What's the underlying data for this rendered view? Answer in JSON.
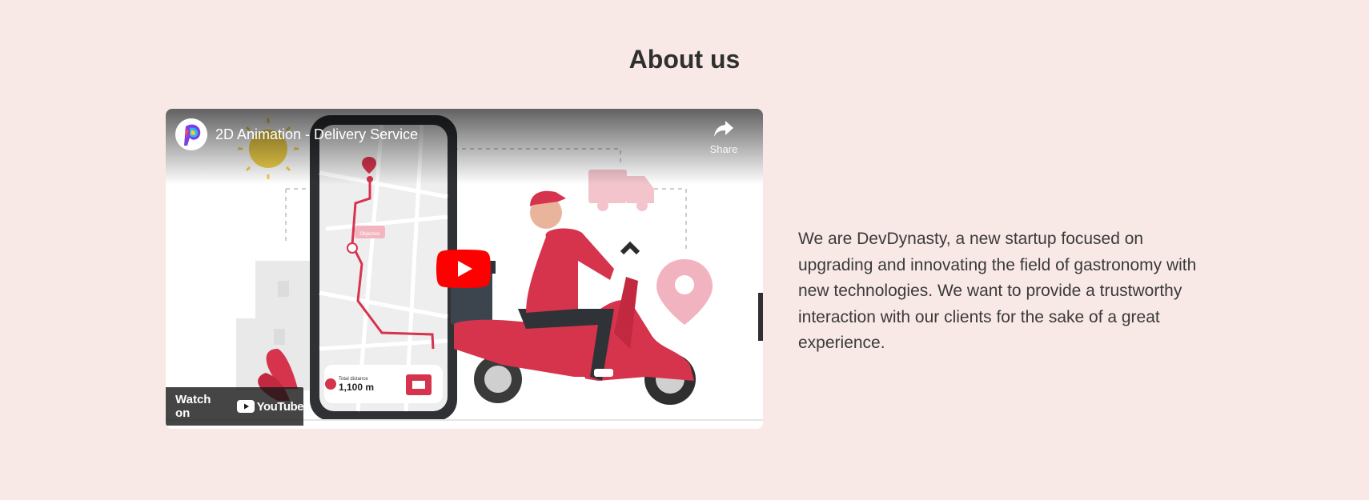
{
  "section": {
    "title": "About us",
    "description": "We are DevDynasty, a new startup focused on upgrading and innovating the field of gastronomy with new technologies. We want to provide a trustworthy interaction with our clients for the sake of a great experience."
  },
  "video": {
    "title": "2D Animation - Delivery Service",
    "share_label": "Share",
    "watch_on_label": "Watch on",
    "youtube_label": "YouTube",
    "play_icon": "play-icon",
    "share_icon": "share-icon",
    "thumbnail": {
      "map_tag": "Objective",
      "distance_label": "Total distance",
      "distance_value": "1,100 m"
    }
  },
  "colors": {
    "background": "#f8e9e7",
    "accent_red": "#d6334d",
    "youtube_red": "#ff0000"
  }
}
